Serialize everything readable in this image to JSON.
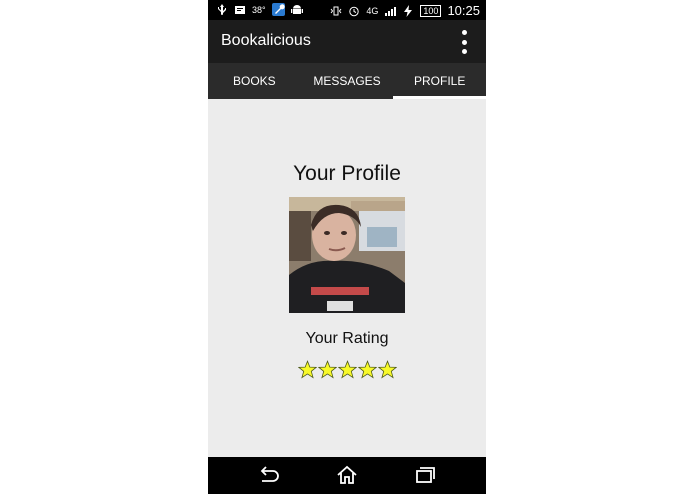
{
  "status_bar": {
    "temperature": "38°",
    "network": "4G",
    "battery": "100",
    "clock": "10:25"
  },
  "app_bar": {
    "title": "Bookalicious"
  },
  "tabs": [
    {
      "label": "BOOKS",
      "active": false
    },
    {
      "label": "MESSAGES",
      "active": false
    },
    {
      "label": "PROFILE",
      "active": true
    }
  ],
  "profile": {
    "title": "Your Profile",
    "rating_label": "Your Rating",
    "rating": 5,
    "rating_max": 5,
    "star_color": "#f7f92b"
  },
  "icons": {
    "overflow": "more-vert-icon",
    "back": "back-icon",
    "home": "home-icon",
    "recents": "recents-icon"
  }
}
